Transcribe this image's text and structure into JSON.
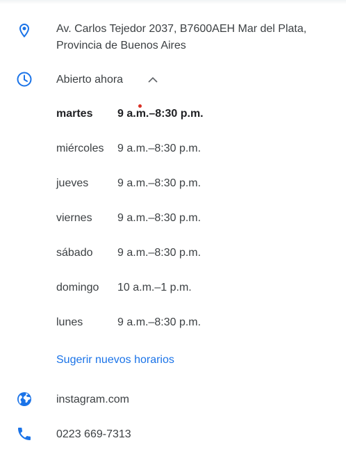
{
  "address": {
    "line1": "Av. Carlos Tejedor 2037, B7600AEH Mar del Plata,",
    "line2": "Provincia de Buenos Aires",
    "icon": "location-pin-icon"
  },
  "hours": {
    "status": "Abierto ahora",
    "icon": "clock-icon",
    "toggle_icon": "chevron-up-icon",
    "rows": [
      {
        "day": "martes",
        "time": "9 a.m.–8:30 p.m.",
        "current": true
      },
      {
        "day": "miércoles",
        "time": "9 a.m.–8:30 p.m."
      },
      {
        "day": "jueves",
        "time": "9 a.m.–8:30 p.m."
      },
      {
        "day": "viernes",
        "time": "9 a.m.–8:30 p.m."
      },
      {
        "day": "sábado",
        "time": "9 a.m.–8:30 p.m."
      },
      {
        "day": "domingo",
        "time": "10 a.m.–1 p.m."
      },
      {
        "day": "lunes",
        "time": "9 a.m.–8:30 p.m."
      }
    ],
    "suggest_label": "Sugerir nuevos horarios"
  },
  "website": {
    "label": "instagram.com",
    "icon": "globe-icon"
  },
  "phone": {
    "label": "0223 669-7313",
    "icon": "phone-icon"
  },
  "colors": {
    "icon_blue": "#1a73e8",
    "text": "#3c4043",
    "link": "#1a73e8",
    "live_dot": "#d93025"
  }
}
